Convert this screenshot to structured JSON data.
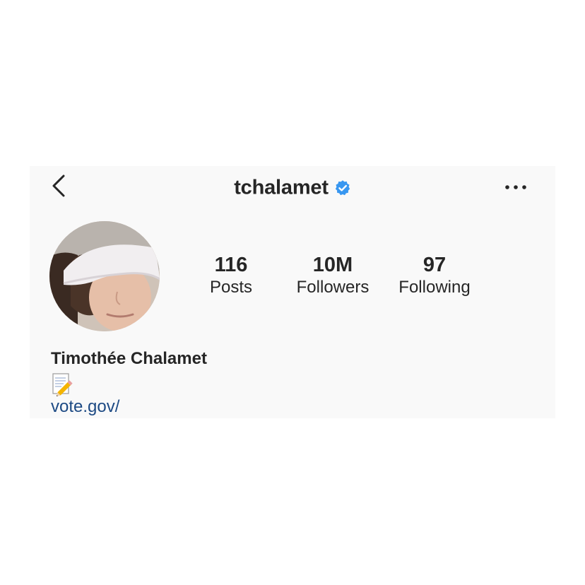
{
  "profile": {
    "username": "tchalamet",
    "verified": true,
    "full_name": "Timothée Chalamet",
    "bio_link": "vote.gov/",
    "bio_emoji_icon": "memo-pencil-icon"
  },
  "header": {
    "back_icon": "chevron-left-icon",
    "more_icon": "more-horizontal-icon"
  },
  "stats": [
    {
      "value": "116",
      "label": "Posts"
    },
    {
      "value": "10M",
      "label": "Followers"
    },
    {
      "value": "97",
      "label": "Following"
    }
  ],
  "colors": {
    "panel_background": "#f9f9f9",
    "text": "#262626",
    "link": "#1d4a84",
    "verified_blue": "#3897f0"
  }
}
